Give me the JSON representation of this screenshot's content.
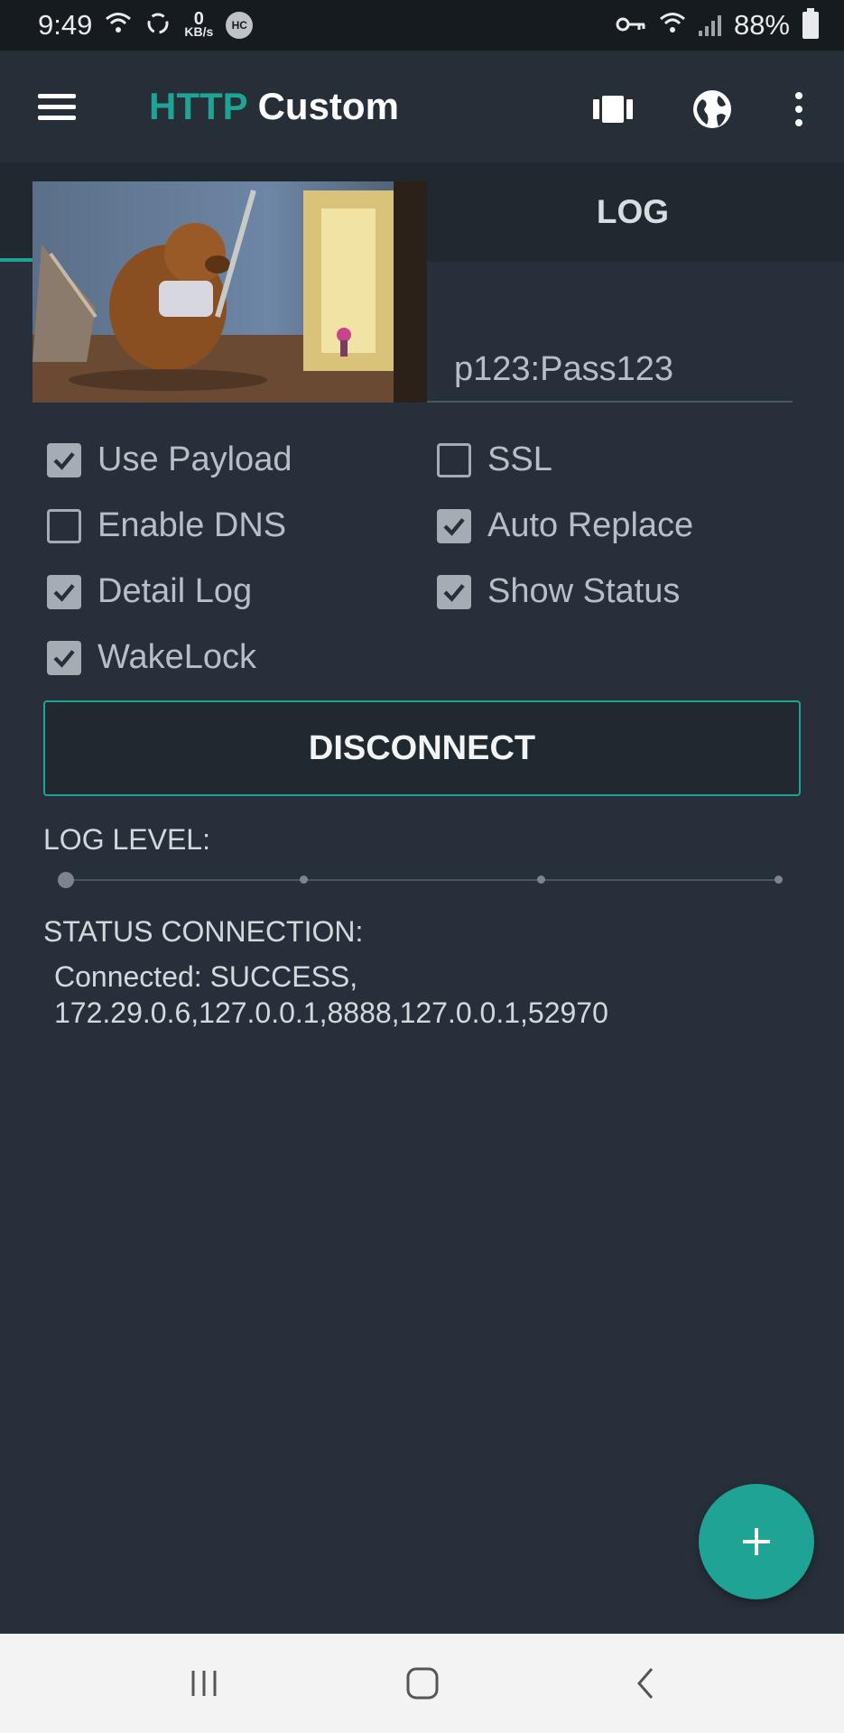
{
  "status_bar": {
    "time": "9:49",
    "net_speed_value": "0",
    "net_speed_unit": "KB/s",
    "hc_badge": "HC",
    "battery": "88%"
  },
  "app": {
    "title_part1": "HTTP",
    "title_part2": "Custom",
    "accent_color": "#1fa394",
    "background_color": "#27303a"
  },
  "tabs": {
    "log_label": "LOG"
  },
  "account_field": {
    "value_visible": "p123:Pass123"
  },
  "checkboxes": [
    {
      "label": "Use Payload",
      "checked": true
    },
    {
      "label": "SSL",
      "checked": false
    },
    {
      "label": "Enable DNS",
      "checked": false
    },
    {
      "label": "Auto Replace",
      "checked": true
    },
    {
      "label": "Detail Log",
      "checked": true
    },
    {
      "label": "Show Status",
      "checked": true
    },
    {
      "label": "WakeLock",
      "checked": true
    }
  ],
  "disconnect_label": "DISCONNECT",
  "log_level": {
    "label": "LOG LEVEL:",
    "steps": 4,
    "selected_index": 0
  },
  "status": {
    "label": "STATUS CONNECTION:",
    "line1": "Connected: SUCCESS,",
    "line2": "172.29.0.6,127.0.0.1,8888,127.0.0.1,52970"
  },
  "fab_icon": "plus-icon",
  "icons": {
    "menu": "hamburger-icon",
    "toolbar_1": "carousel-icon",
    "toolbar_2": "globe-icon",
    "toolbar_3": "more-vert-icon",
    "nav_recents": "recents-icon",
    "nav_home": "home-icon",
    "nav_back": "back-icon"
  }
}
